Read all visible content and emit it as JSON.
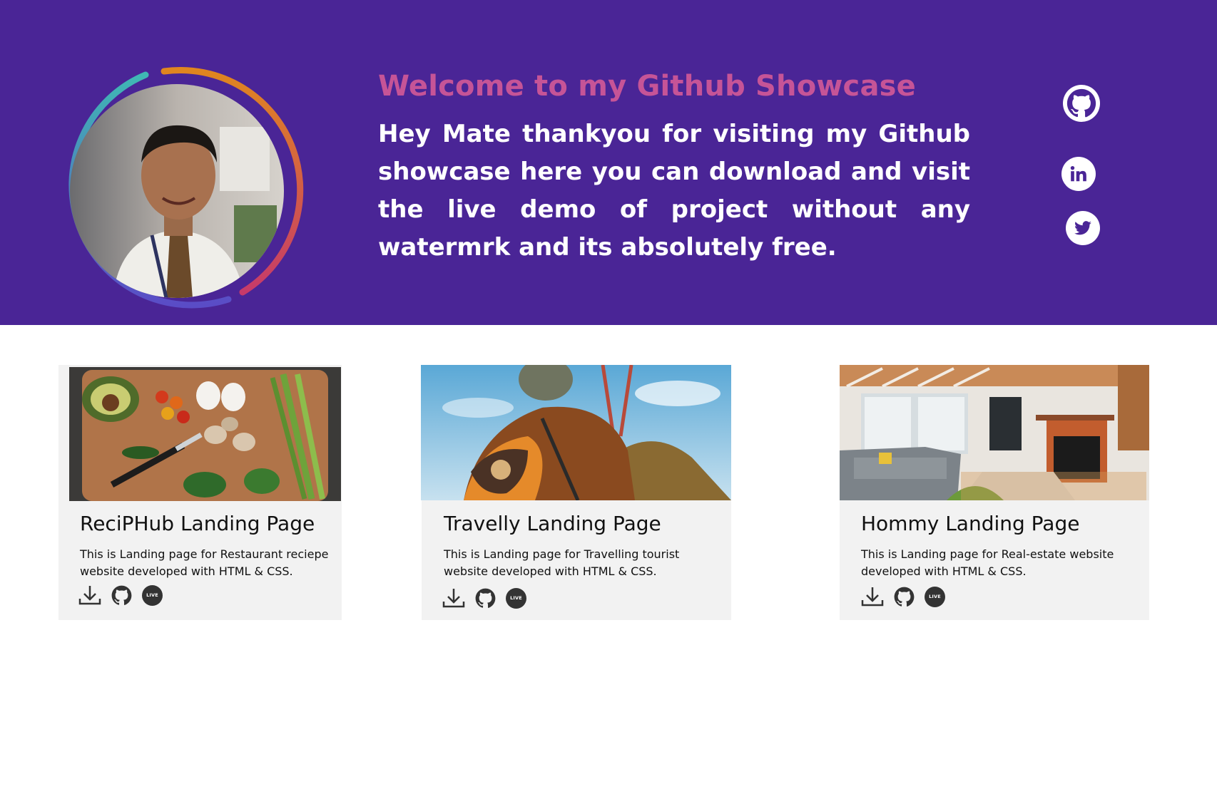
{
  "hero": {
    "title": "Welcome to my Github Showcase",
    "text": "Hey Mate thankyou for visiting my Github showcase here you can download and visit the live demo of project without any watermrk and its absolutely free.",
    "background": "#4a2596",
    "title_color": "#c65497"
  },
  "social": [
    {
      "icon": "github-icon"
    },
    {
      "icon": "linkedin-icon"
    },
    {
      "icon": "twitter-icon"
    }
  ],
  "projects": [
    {
      "title": "ReciPHub Landing Page",
      "description": "This is Landing page for Restaurant reciepe website developed with HTML & CSS.",
      "image": "vegetables-on-cutting-board",
      "actions": [
        "download-icon",
        "github-icon",
        "live-badge"
      ],
      "live_label": "LIVE"
    },
    {
      "title": "Travelly Landing Page",
      "description": "This is Landing page for Travelling tourist website developed with HTML & CSS.",
      "image": "hiker-with-backpack",
      "actions": [
        "download-icon",
        "github-icon",
        "live-badge"
      ],
      "live_label": "LIVE"
    },
    {
      "title": "Hommy Landing Page",
      "description": "This is Landing page  for Real-estate website developed with HTML & CSS.",
      "image": "living-room-interior",
      "actions": [
        "download-icon",
        "github-icon",
        "live-badge"
      ],
      "live_label": "LIVE"
    }
  ]
}
